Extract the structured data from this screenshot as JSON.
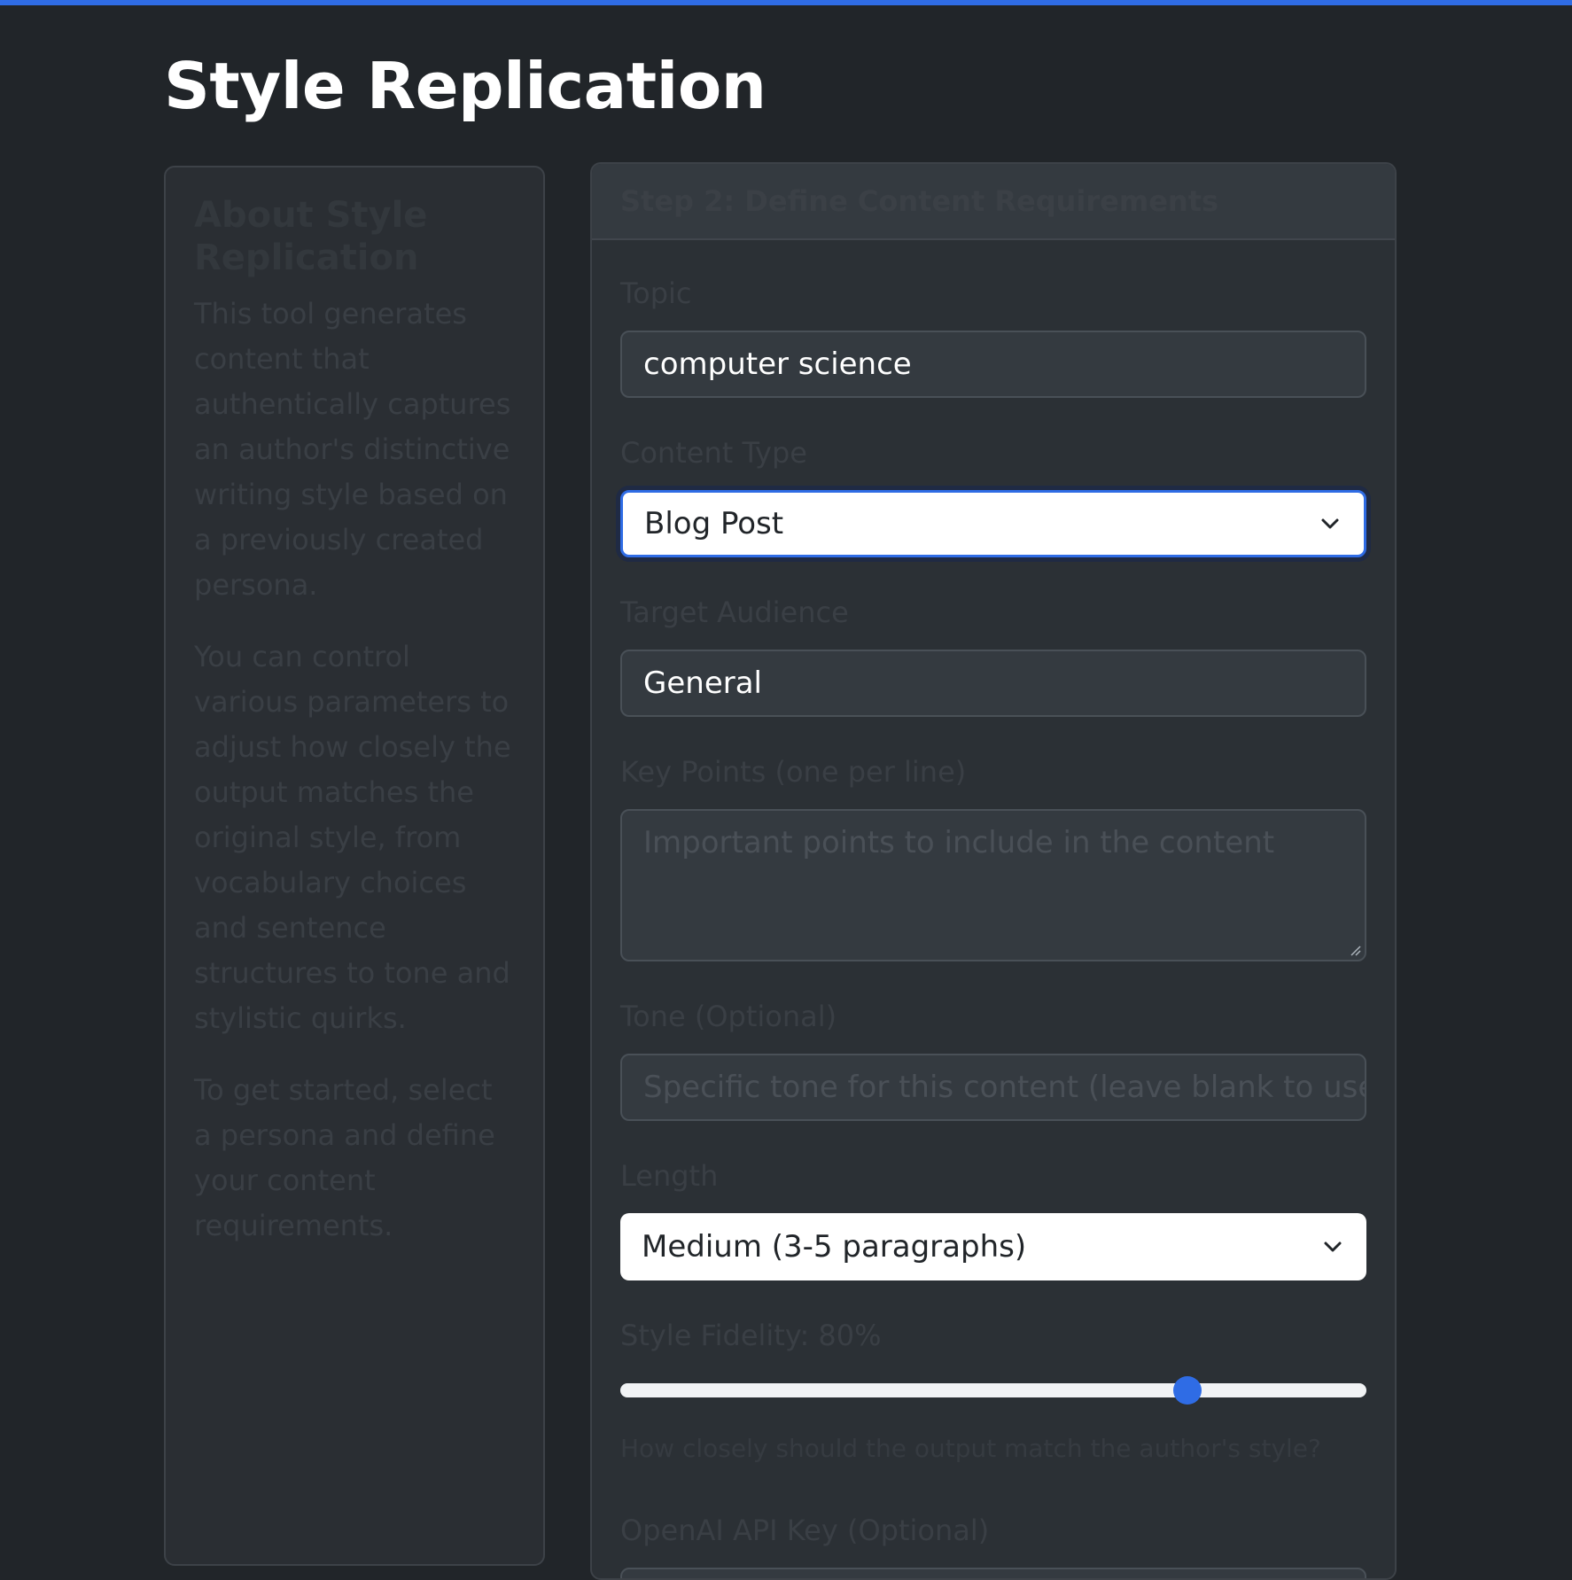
{
  "page": {
    "title": "Style Replication"
  },
  "colors": {
    "accent": "#2f6ce5",
    "background": "#212529",
    "card": "#2b3035"
  },
  "sidebar": {
    "heading": "About Style Replication",
    "paragraphs": [
      "This tool generates content that authentically captures an author's distinctive writing style based on a previously created persona.",
      "You can control various parameters to adjust how closely the output matches the original style, from vocabulary choices and sentence structures to tone and stylistic quirks.",
      "To get started, select a persona and define your content requirements."
    ]
  },
  "step": {
    "heading": "Step 2: Define Content Requirements",
    "topic": {
      "label": "Topic",
      "value": "computer science"
    },
    "content_type": {
      "label": "Content Type",
      "value": "Blog Post"
    },
    "audience": {
      "label": "Target Audience",
      "value": "General"
    },
    "key_points": {
      "label": "Key Points (one per line)",
      "placeholder": "Important points to include in the content"
    },
    "tone": {
      "label": "Tone (Optional)",
      "placeholder": "Specific tone for this content (leave blank to use author's default tone)"
    },
    "length": {
      "label": "Length",
      "value": "Medium (3-5 paragraphs)"
    },
    "fidelity": {
      "label": "Style Fidelity: 80%",
      "value_percent": 80,
      "slider_position_fraction": 0.76,
      "help": "How closely should the output match the author's style?"
    },
    "api_key": {
      "label": "OpenAI API Key (Optional)"
    }
  },
  "icons": {
    "select_arrow": "chevron-down-icon",
    "resize": "resize-grip-icon"
  }
}
